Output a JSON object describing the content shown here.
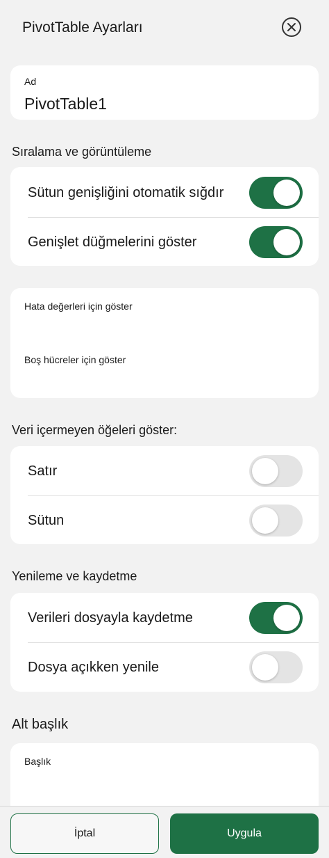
{
  "header": {
    "title": "PivotTable Ayarları",
    "close_icon": "close-circle-icon"
  },
  "name_field": {
    "label": "Ad",
    "value": "PivotTable1"
  },
  "sorting_display": {
    "title": "Sıralama ve görüntüleme",
    "items": [
      {
        "label": "Sütun genişliğini otomatik sığdır",
        "on": true
      },
      {
        "label": "Genişlet düğmelerini göster",
        "on": true
      }
    ]
  },
  "show_values": {
    "error_label": "Hata değerleri için göster",
    "empty_label": "Boş hücreler için göster"
  },
  "no_data_items": {
    "title": "Veri içermeyen öğeleri göster:",
    "items": [
      {
        "label": "Satır",
        "on": false
      },
      {
        "label": "Sütun",
        "on": false
      }
    ]
  },
  "refresh_save": {
    "title": "Yenileme ve kaydetme",
    "items": [
      {
        "label": "Verileri dosyayla kaydetme",
        "on": true
      },
      {
        "label": "Dosya açıkken yenile",
        "on": false
      }
    ]
  },
  "alt_text": {
    "title": "Alt başlık",
    "caption_label": "Başlık"
  },
  "footer": {
    "cancel_label": "İptal",
    "apply_label": "Uygula"
  },
  "colors": {
    "accent": "#1e7145",
    "background": "#f2f2f2",
    "card": "#ffffff",
    "toggle_off": "#e4e4e4"
  }
}
